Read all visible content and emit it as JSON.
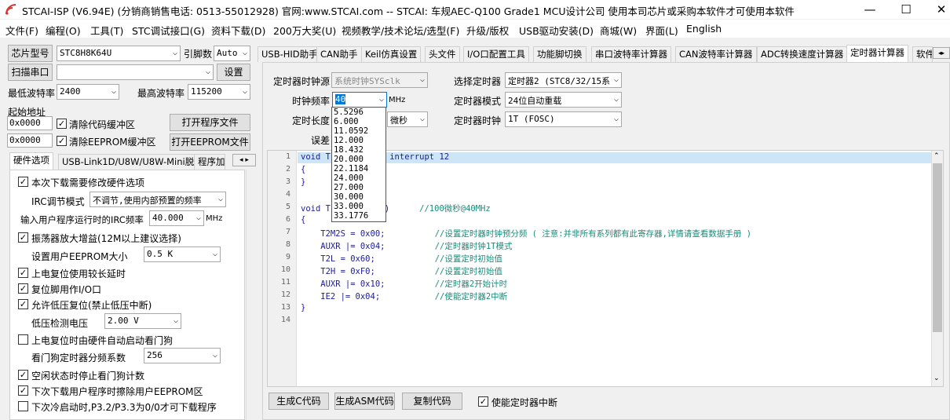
{
  "window": {
    "title": "STCAI-ISP (V6.94E) (分销商销售电话: 0513-55012928) 官网:www.STCAI.com  -- STCAI: 车规AEC-Q100 Grade1 MCU设计公司 使用本司芯片或采购本软件才可使用本软件",
    "minimize": "—",
    "maximize": "☐",
    "close": "✕"
  },
  "menu": [
    "文件(F)",
    "编程(O)",
    "工具(T)",
    "STC调试接口(G)",
    "资料下载(D)",
    "200万大奖(U)",
    "视频教学/技术论坛/选型(F)",
    "升级/版权",
    "USB驱动安装(D)",
    "商城(W)",
    "界面(L)",
    "English"
  ],
  "left": {
    "chip_btn": "芯片型号",
    "chip_value": "STC8H8K64U",
    "pin_label": "引脚数",
    "pin_value": "Auto",
    "scan_btn": "扫描串口",
    "port_value": "",
    "settings_btn": "设置",
    "min_baud_label": "最低波特率",
    "min_baud": "2400",
    "max_baud_label": "最高波特率",
    "max_baud": "115200",
    "start_addr_label": "起始地址",
    "addr1": "0x0000",
    "clear_code": "清除代码缓冲区",
    "open_prog": "打开程序文件",
    "addr2": "0x0000",
    "clear_eeprom": "清除EEPROM缓冲区",
    "open_eeprom": "打开EEPROM文件",
    "tabs": [
      "硬件选项",
      "USB-Link1D/U8W/U8W-Mini脱机",
      "程序加"
    ],
    "hw": {
      "opt1": "本次下载需要修改硬件选项",
      "irc_label": "IRC调节模式",
      "irc_value": "不调节,使用内部预置的频率",
      "freq_label": "输入用户程序运行时的IRC频率",
      "freq_value": "40.000",
      "freq_unit": "MHz",
      "opt2": "振荡器放大增益(12M以上建议选择)",
      "eeprom_label": "设置用户EEPROM大小",
      "eeprom_value": "0.5 K",
      "opt3": "上电复位使用较长延时",
      "opt4": "复位脚用作I/O口",
      "opt5": "允许低压复位(禁止低压中断)",
      "lv_label": "低压检测电压",
      "lv_value": "2.00 V",
      "opt6": "上电复位时由硬件自动启动看门狗",
      "wdt_label": "看门狗定时器分频系数",
      "wdt_value": "256",
      "opt7": "空闲状态时停止看门狗计数",
      "opt8": "下次下载用户程序时擦除用户EEPROM区",
      "opt9": "下次冷启动时,P3.2/P3.3为0/0才可下载程序"
    }
  },
  "right": {
    "tabs": [
      "USB-HID助手",
      "CAN助手",
      "Keil仿真设置",
      "头文件",
      "I/O口配置工具",
      "功能脚切换",
      "串口波特率计算器",
      "CAN波特率计算器",
      "ADC转换速度计算器",
      "定时器计算器",
      "软件"
    ],
    "clk_src_label": "定时器时钟源",
    "clk_src_value": "系统时钟SYSclk",
    "sel_timer_label": "选择定时器",
    "sel_timer_value": "定时器2 (STC8/32/15系",
    "freq_label": "时钟频率",
    "freq_value": "40",
    "freq_unit": "MHz",
    "mode_label": "定时器模式",
    "mode_value": "24位自动重载",
    "len_label": "定时长度",
    "len_unit": "微秒",
    "tclk_label": "定时器时钟",
    "tclk_value": "1T  (FOSC)",
    "err_label": "误差",
    "dropdown": [
      "5.5296",
      "6.000",
      "11.0592",
      "12.000",
      "18.432",
      "20.000",
      "22.1184",
      "24.000",
      "27.000",
      "30.000",
      "33.000",
      "33.1776"
    ],
    "code_lines": [
      {
        "n": "1",
        "t": "void T",
        "c": "id) interrupt 12"
      },
      {
        "n": "2",
        "t": "{",
        "c": ""
      },
      {
        "n": "3",
        "t": "}",
        "c": ""
      },
      {
        "n": "4",
        "t": "",
        "c": ""
      },
      {
        "n": "5",
        "t": "void T",
        "c": "oid)      //100微秒@40MHz"
      },
      {
        "n": "6",
        "t": "{",
        "c": ""
      },
      {
        "n": "7",
        "t": "    T2M2S = 0x00;          ",
        "c": "//设置定时器时钟预分频 ( 注意:并非所有系列都有此寄存器,详情请查看数据手册 )"
      },
      {
        "n": "8",
        "t": "    AUXR |= 0x04;          ",
        "c": "//定时器时钟1T模式"
      },
      {
        "n": "9",
        "t": "    T2L = 0x60;            ",
        "c": "//设置定时初始值"
      },
      {
        "n": "10",
        "t": "    T2H = 0xF0;            ",
        "c": "//设置定时初始值"
      },
      {
        "n": "11",
        "t": "    AUXR |= 0x10;          ",
        "c": "//定时器2开始计时"
      },
      {
        "n": "12",
        "t": "    IE2 |= 0x04;           ",
        "c": "//使能定时器2中断"
      },
      {
        "n": "13",
        "t": "}",
        "c": ""
      },
      {
        "n": "14",
        "t": "",
        "c": ""
      }
    ],
    "gen_c": "生成C代码",
    "gen_asm": "生成ASM代码",
    "copy_code": "复制代码",
    "enable_int": "使能定时器中断"
  }
}
